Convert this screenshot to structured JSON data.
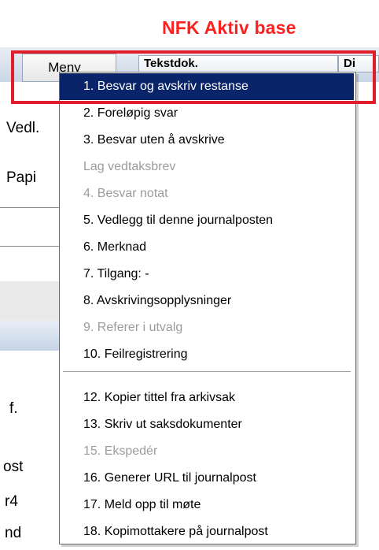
{
  "app": {
    "title": "NFK Aktiv base",
    "title_color": "#ff1f1f"
  },
  "toolbar": {
    "menu_button_label": "Meny",
    "col_tekstdok": "Tekstdok.",
    "col_di": "Di"
  },
  "left_panel": {
    "vedl_label": "Vedl.",
    "papi_label": "Papi",
    "text_f": "f.",
    "text_ost": "ost",
    "text_r4": "r4",
    "text_nd": "nd"
  },
  "popup_menu": {
    "items": [
      {
        "label": "1. Besvar og avskriv restanse",
        "state": "selected"
      },
      {
        "label": "2. Foreløpig svar",
        "state": "enabled"
      },
      {
        "label": "3. Besvar uten å avskrive",
        "state": "enabled"
      },
      {
        "label": "Lag vedtaksbrev",
        "state": "disabled"
      },
      {
        "label": "4. Besvar notat",
        "state": "disabled"
      },
      {
        "label": "5. Vedlegg til denne journalposten",
        "state": "enabled"
      },
      {
        "label": "6. Merknad",
        "state": "enabled"
      },
      {
        "label": "7. Tilgang: -",
        "state": "enabled"
      },
      {
        "label": "8. Avskrivingsopplysninger",
        "state": "enabled"
      },
      {
        "label": "9. Referer i utvalg",
        "state": "disabled"
      },
      {
        "label": "10. Feilregistrering",
        "state": "enabled"
      },
      {
        "label": "12. Kopier tittel fra arkivsak",
        "state": "enabled"
      },
      {
        "label": "13. Skriv ut saksdokumenter",
        "state": "enabled"
      },
      {
        "label": "15. Ekspedér",
        "state": "disabled"
      },
      {
        "label": "16. Generer URL til journalpost",
        "state": "enabled"
      },
      {
        "label": "17. Meld opp til møte",
        "state": "enabled"
      },
      {
        "label": "18. Kopimottakere på journalpost",
        "state": "enabled"
      }
    ],
    "selected_bg": "#0a246a",
    "disabled_color": "#9c9c9c"
  },
  "annotation": {
    "highlight_color": "#e21d2b"
  }
}
